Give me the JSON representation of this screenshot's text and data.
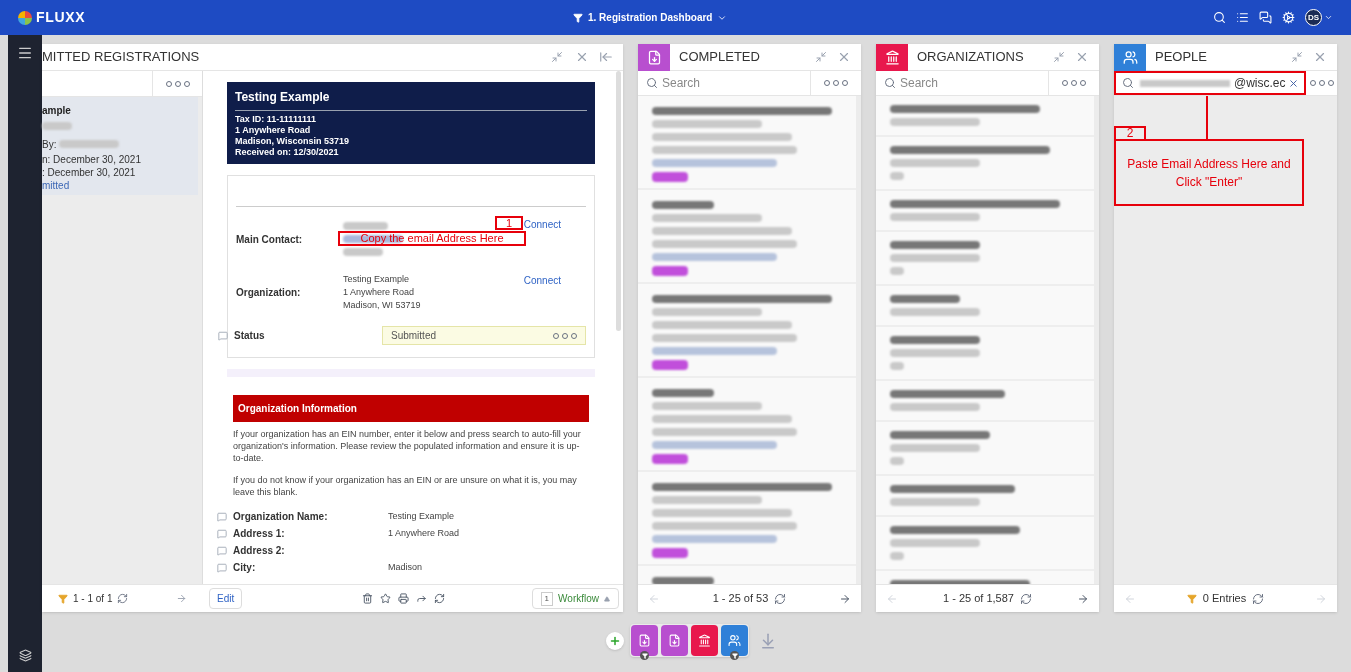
{
  "topbar": {
    "logo": "FLUXX",
    "dashboard": "1. Registration Dashboard",
    "avatar": "DS"
  },
  "registrations": {
    "title": "MITTED REGISTRATIONS",
    "card": {
      "title": "ample",
      "by": "By:",
      "submitted": "n: December 30, 2021",
      "updated": ": December 30, 2021",
      "status": "mitted",
      "selected": true
    },
    "count": "1 - 1 of 1",
    "detail": {
      "title": "Testing Example",
      "lines": [
        "Tax ID: 11-11111111",
        "1 Anywhere Road",
        "Madison, Wisconsin 53719",
        "Received on: 12/30/2021"
      ],
      "contacts": [
        {
          "label": "Main Contact:",
          "link": "Connect"
        },
        {
          "label": "Organization:",
          "link": "Connect",
          "lines": [
            "Testing Example",
            "1 Anywhere Road",
            "Madison, WI 53719"
          ]
        }
      ],
      "note_number": "1",
      "note": "Copy the email Address Here",
      "status": {
        "label": "Status",
        "value": "Submitted"
      },
      "section": {
        "title": "Organization Information",
        "paragraphs": [
          "If your organization has an EIN number, enter it below and press search to auto-fill your organization's information. Please review the populated information and ensure it is up-to-date.",
          "If you do not know if your organization has an EIN or are unsure on what it is, you may leave this blank."
        ],
        "fields": [
          {
            "label": "Organization Name:",
            "value": "Testing Example"
          },
          {
            "label": "Address 1:",
            "value": "1 Anywhere Road"
          },
          {
            "label": "Address 2:"
          },
          {
            "label": "City:",
            "value": "Madison"
          }
        ]
      },
      "edit": "Edit",
      "workflow_count": "1",
      "workflow": "Workflow"
    }
  },
  "columns": [
    {
      "kind": "completed",
      "title": "COMPLETED",
      "color": "#b84fcf",
      "search": {
        "placeholder": "Search"
      },
      "footer": "1 - 25 of 53"
    },
    {
      "kind": "organizations",
      "title": "ORGANIZATIONS",
      "color": "#e8184d",
      "search": {
        "placeholder": "Search"
      },
      "footer": "1 - 25 of 1,587"
    },
    {
      "kind": "people",
      "title": "PEOPLE",
      "color": "#2f80d8",
      "search": {
        "value": "@wisc.ec"
      },
      "footer": "0 Entries",
      "note_number": "2",
      "note": "Paste Email Address Here and Click \"Enter\""
    }
  ],
  "dock": [
    {
      "kind": "document",
      "color": "#b84fcf",
      "filtered": true
    },
    {
      "kind": "document",
      "color": "#b84fcf",
      "filtered": false
    },
    {
      "kind": "organizations",
      "color": "#e8184d",
      "filtered": false
    },
    {
      "kind": "people",
      "color": "#2f80d8",
      "filtered": true
    }
  ]
}
